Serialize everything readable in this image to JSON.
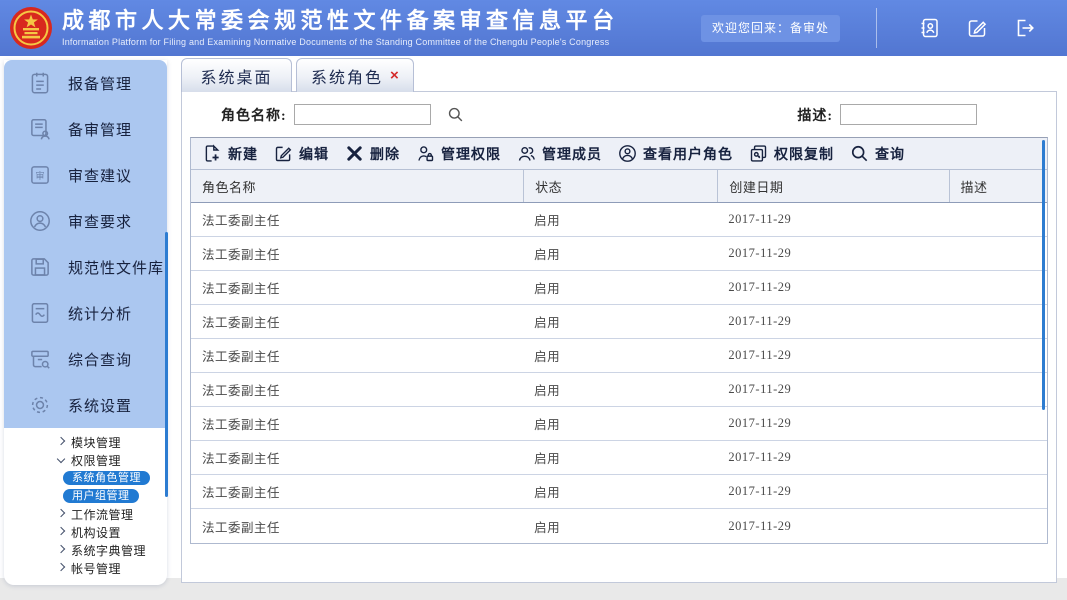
{
  "colors": {
    "header-blue": "#5a80d9",
    "welcome-blue": "#6e92e4",
    "sidebar-blue": "#abc7f0",
    "accent-blue": "#217ad2",
    "scrollbar-blue": "#2d7cd1",
    "tab-border": "#b6bfd6",
    "panel-border": "#c2c9da",
    "toolbar-bg": "#edf0f7",
    "headrow-bg": "#eef1f7",
    "row-border": "#ccd4e4",
    "ink": "#17223f",
    "close-red": "#d42a2a",
    "footer-gray": "#e9e9e9"
  },
  "header": {
    "title": "成都市人大常委会规范性文件备案审查信息平台",
    "subtitle": "Information Platform for Filing and Examining Normative Documents of the Standing Committee of the Chengdu People's Congress",
    "welcome": "欢迎您回来：备审处",
    "icons": [
      "contact-card-icon",
      "edit-note-icon",
      "logout-icon"
    ]
  },
  "sidebar": {
    "items": [
      {
        "label": "报备管理",
        "icon": "clipboard-icon"
      },
      {
        "label": "备审管理",
        "icon": "document-user-icon"
      },
      {
        "label": "审查建议",
        "icon": "review-stamp-icon"
      },
      {
        "label": "审查要求",
        "icon": "user-circle-icon"
      },
      {
        "label": "规范性文件库",
        "icon": "floppy-disk-icon"
      },
      {
        "label": "统计分析",
        "icon": "chart-document-icon"
      },
      {
        "label": "综合查询",
        "icon": "archive-search-icon"
      },
      {
        "label": "系统设置",
        "icon": "gear-icon"
      }
    ],
    "tree": [
      {
        "label": "模块管理",
        "state": "collapsed"
      },
      {
        "label": "权限管理",
        "state": "expanded"
      },
      {
        "label": "工作流管理",
        "state": "collapsed"
      },
      {
        "label": "机构设置",
        "state": "collapsed"
      },
      {
        "label": "系统字典管理",
        "state": "collapsed"
      },
      {
        "label": "帐号管理",
        "state": "collapsed"
      }
    ],
    "tree_children": [
      {
        "label": "系统角色管理",
        "selected": true
      },
      {
        "label": "用户组管理",
        "selected": true
      }
    ]
  },
  "tabs": [
    {
      "label": "系统桌面"
    },
    {
      "label": "系统角色",
      "close_glyph": "×"
    }
  ],
  "search": {
    "role_name_label": "角色名称:",
    "role_name_value": "",
    "role_name_placeholder": "",
    "desc_label": "描述:",
    "desc_value": "",
    "desc_placeholder": ""
  },
  "toolbar": {
    "buttons": [
      {
        "label": "新建",
        "icon": "new-document-icon"
      },
      {
        "label": "编辑",
        "icon": "edit-pencil-icon"
      },
      {
        "label": "删除",
        "icon": "delete-x-icon"
      },
      {
        "label": "管理权限",
        "icon": "user-lock-icon"
      },
      {
        "label": "管理成员",
        "icon": "users-icon"
      },
      {
        "label": "查看用户角色",
        "icon": "user-role-icon"
      },
      {
        "label": "权限复制",
        "icon": "copy-permission-icon"
      },
      {
        "label": "查询",
        "icon": "magnifier-icon"
      }
    ]
  },
  "table": {
    "columns": [
      "角色名称",
      "状态",
      "创建日期",
      "描述"
    ],
    "rows": [
      [
        "法工委副主任",
        "启用",
        "2017-11-29",
        ""
      ],
      [
        "法工委副主任",
        "启用",
        "2017-11-29",
        ""
      ],
      [
        "法工委副主任",
        "启用",
        "2017-11-29",
        ""
      ],
      [
        "法工委副主任",
        "启用",
        "2017-11-29",
        ""
      ],
      [
        "法工委副主任",
        "启用",
        "2017-11-29",
        ""
      ],
      [
        "法工委副主任",
        "启用",
        "2017-11-29",
        ""
      ],
      [
        "法工委副主任",
        "启用",
        "2017-11-29",
        ""
      ],
      [
        "法工委副主任",
        "启用",
        "2017-11-29",
        ""
      ],
      [
        "法工委副主任",
        "启用",
        "2017-11-29",
        ""
      ],
      [
        "法工委副主任",
        "启用",
        "2017-11-29",
        ""
      ]
    ]
  }
}
